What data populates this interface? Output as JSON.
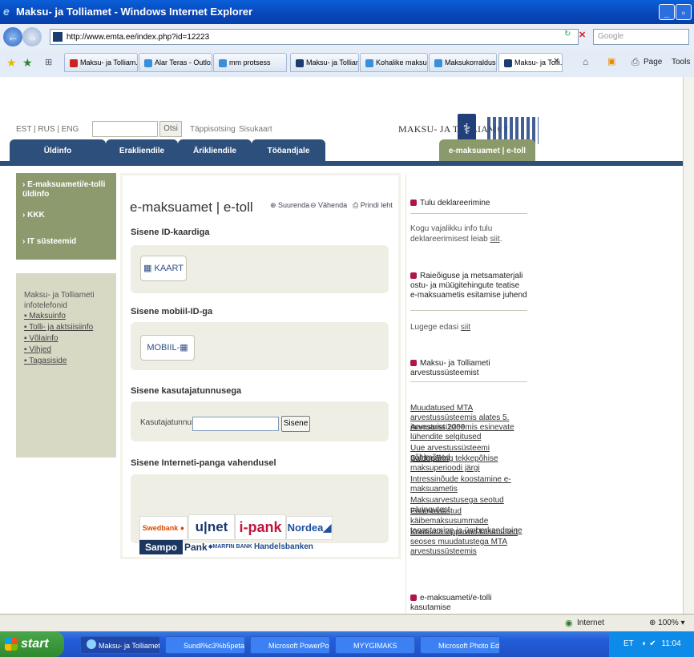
{
  "window": {
    "title": "Maksu- ja Tolliamet - Windows Internet Explorer"
  },
  "address": {
    "url": "http://www.emta.ee/index.php?id=12223",
    "search_placeholder": "Google"
  },
  "browser_tabs": [
    {
      "label": "Maksu- ja Tolliam..."
    },
    {
      "label": "Alar Teras - Outlo..."
    },
    {
      "label": "mm protsess"
    },
    {
      "label": "Maksu- ja Tolliamet"
    },
    {
      "label": "Kohalike maksude..."
    },
    {
      "label": "Maksukorralduse ..."
    },
    {
      "label": "Maksu- ja Tolli..."
    }
  ],
  "toolbar": {
    "page": "Page",
    "tools": "Tools"
  },
  "site": {
    "langs": "EST | RUS | ENG",
    "search_button": "Otsi",
    "advanced_search": "Täppisotsing",
    "sitemap": "Sisukaart",
    "logo_text": "MAKSU- JA TOLLIAMET",
    "menu": [
      "Üldinfo",
      "Erakliendile",
      "Ärikliendile",
      "Tööandjale"
    ],
    "menu_right": "e-maksuamet | e-toll"
  },
  "left": {
    "items": [
      "E-maksuameti/e-tolli üldinfo",
      "KKK",
      "IT süsteemid"
    ],
    "info_title": "Maksu- ja Tolliameti infotelefonid",
    "info_links": [
      "Maksuinfo",
      "Tolli- ja aktsiisiinfo",
      "Võlainfo",
      "Vihjed",
      "Tagasiside"
    ]
  },
  "main": {
    "title": "e-maksuamet | e-toll",
    "zoom_in": "Suurenda",
    "zoom_out": "Vähenda",
    "print": "Prindi leht",
    "id_card_heading": "Sisene ID-kaardiga",
    "id_card_button": "KAART",
    "mobile_heading": "Sisene mobiil-ID-ga",
    "mobile_button": "MOBIIL-",
    "user_heading": "Sisene kasutajatunnusega",
    "user_label": "Kasutajatunnus:",
    "user_button": "Sisene",
    "bank_heading": "Sisene Interneti-panga vahendusel",
    "banks": [
      "Swedbank",
      "u|net",
      "i-pank",
      "Nordea",
      "Sampo",
      "Pank",
      "MARFIN BANK",
      "Handelsbanken"
    ]
  },
  "right": {
    "h1": "Tulu deklareerimine",
    "t1": "Kogu vajalikku info tulu deklareerimisest leiab",
    "t1_link": "siit",
    "h2": "Raieõiguse ja metsamaterjali ostu- ja müügitehingute teatise e-maksuametis esitamise juhend",
    "t2": "Lugege edasi",
    "t2_link": "siit",
    "h3": "Maksu- ja Tolliameti arvestussüsteemist",
    "links": [
      "Muudatused MTA arvestussüsteemis alates 5. jaanuarist 2009",
      "Arvestussüsteemis esinevate lühendite selgitused",
      "Uue arvestussüsteemi põhimõtted",
      "Saldopäring tekkepõhise maksuperioodi järgi",
      "Intressinõude koostamine e-maksuametis",
      "Maksuarvestusega seotud päringutest",
      "Enammakstud käibemaksusummade tagastamine ja ümberkandmine",
      "Korduma kippuvad küsimused seoses muudatustega MTA arvestussüsteemis"
    ],
    "h4": "e-maksuameti/e-tolli kasutamise"
  },
  "status": {
    "zone": "Internet",
    "zoom": "100%"
  },
  "taskbar": {
    "start": "start",
    "tasks": [
      "Maksu- ja Tolliamet - ...",
      "Sundl%c3%b5petami...",
      "Microsoft PowerPoint ...",
      "MYYGIMAKS",
      "Microsoft Photo Edito..."
    ],
    "lang": "ET",
    "time": "11:04"
  }
}
